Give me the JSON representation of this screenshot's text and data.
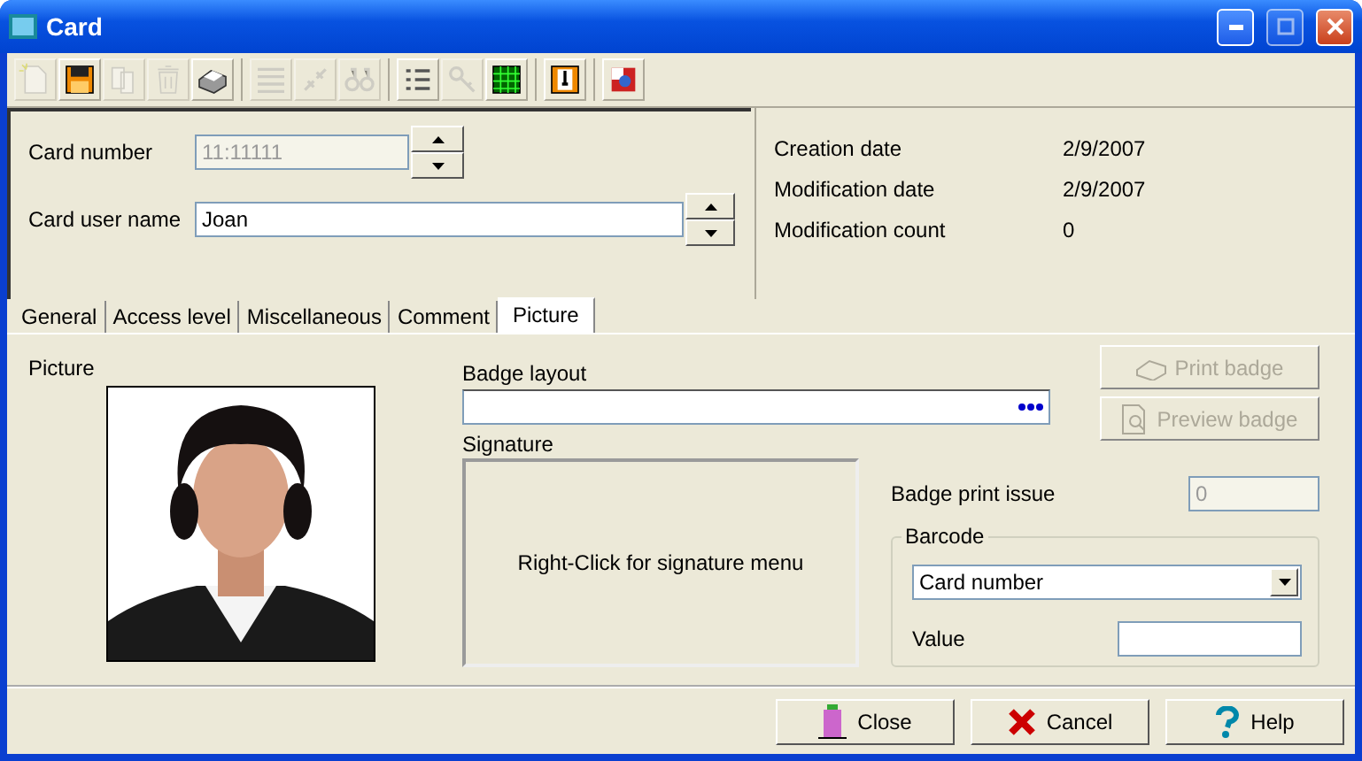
{
  "window": {
    "title": "Card"
  },
  "toolbar": {
    "groups": [
      [
        {
          "disabled": true
        },
        {
          "disabled": false
        },
        {
          "disabled": true
        },
        {
          "disabled": true
        },
        {
          "disabled": false
        }
      ],
      [
        {
          "disabled": true
        },
        {
          "disabled": true
        },
        {
          "disabled": true
        }
      ],
      [
        {
          "disabled": false
        },
        {
          "disabled": true
        },
        {
          "disabled": false
        }
      ],
      [
        {
          "disabled": false
        }
      ],
      [
        {
          "disabled": false
        }
      ]
    ]
  },
  "card_fields": [
    {
      "label": "Card number",
      "value": "11:11111",
      "disabled": true
    },
    {
      "label": "Card user name",
      "value": "Joan",
      "disabled": false
    }
  ],
  "info": [
    {
      "label": "Creation date",
      "value": "2/9/2007"
    },
    {
      "label": "Modification date",
      "value": "2/9/2007"
    },
    {
      "label": "Modification count",
      "value": "0"
    }
  ],
  "tabs": [
    {
      "label": "General",
      "selected": false
    },
    {
      "label": "Access level",
      "selected": false
    },
    {
      "label": "Miscellaneous",
      "selected": false
    },
    {
      "label": "Comment",
      "selected": false
    },
    {
      "label": "Picture",
      "selected": true
    }
  ],
  "picture_tab": {
    "picture_label": "Picture",
    "badge_layout_label": "Badge layout",
    "signature_label": "Signature",
    "signature_hint": "Right-Click for signature menu",
    "actions": [
      {
        "label": "Print badge",
        "disabled": true
      },
      {
        "label": "Preview badge",
        "disabled": true
      }
    ],
    "badge_print_issue": {
      "label": "Badge print issue",
      "value": "0",
      "disabled": true
    },
    "barcode": {
      "title": "Barcode",
      "type": "Card number",
      "value_label": "Value"
    }
  },
  "buttons": [
    {
      "label": "Close"
    },
    {
      "label": "Cancel"
    },
    {
      "label": "Help"
    }
  ]
}
